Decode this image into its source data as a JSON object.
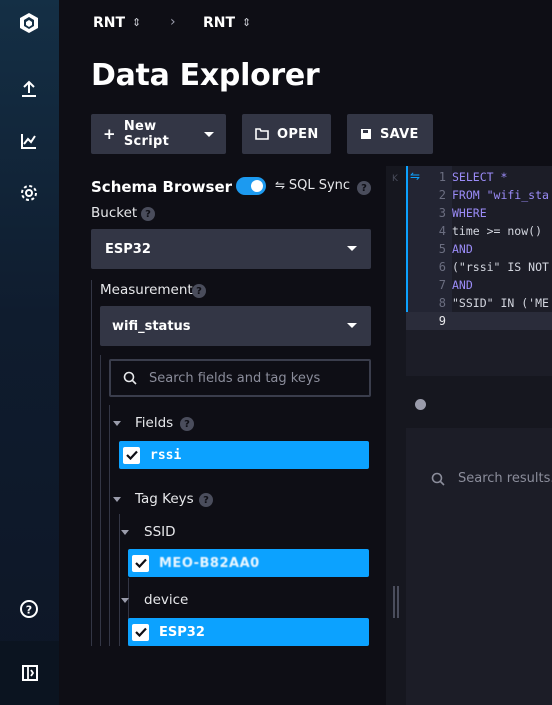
{
  "breadcrumb": {
    "org": "RNT",
    "bucket": "RNT",
    "separator": "›"
  },
  "page": {
    "title": "Data Explorer"
  },
  "toolbar": {
    "new_script": "New Script",
    "open": "OPEN",
    "save": "SAVE"
  },
  "schema": {
    "title": "Schema Browser",
    "sql_sync": "SQL Sync",
    "sql_sync_on": true,
    "bucket_label": "Bucket",
    "bucket_value": "ESP32",
    "measurement_label": "Measurement",
    "measurement_value": "wifi_status",
    "search_placeholder": "Search fields and tag keys",
    "fields_label": "Fields",
    "fields": [
      "rssi"
    ],
    "tag_keys_label": "Tag Keys",
    "tag_ssid_label": "SSID",
    "tag_ssid_value": "MEO-B82AA0",
    "tag_device_label": "device",
    "tag_device_value": "ESP32"
  },
  "editor": {
    "line_numbers": [
      "1",
      "2",
      "3",
      "4",
      "5",
      "6",
      "7",
      "8",
      "9"
    ],
    "lines": [
      "SELECT *",
      "FROM \"wifi_sta",
      "WHERE",
      "time >= now()",
      "AND",
      "(\"rssi\" IS NOT",
      "AND",
      "\"SSID\" IN ('ME",
      ""
    ]
  },
  "results": {
    "search_placeholder": "Search results..."
  },
  "colors": {
    "accent": "#0ca2ff",
    "toggle": "#1c9af0",
    "keyword": "#9b8cf8"
  }
}
